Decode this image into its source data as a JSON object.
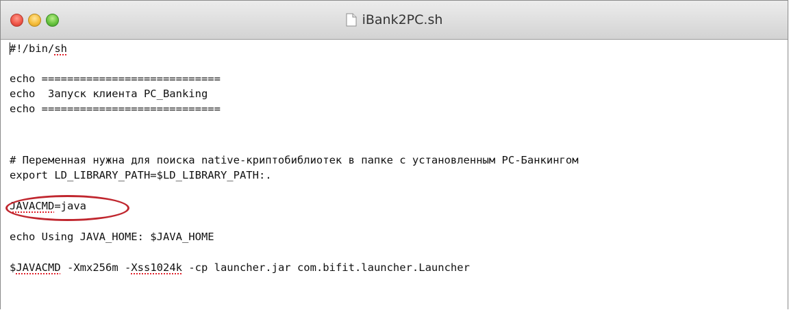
{
  "window": {
    "title": "iBank2PC.sh"
  },
  "editor": {
    "lines": {
      "shebang_prefix": "#!/bin/",
      "shebang_word": "sh",
      "echo_sep_1": "echo ============================",
      "echo_title": "echo  Запуск клиента PC_Banking",
      "echo_sep_2": "echo ============================",
      "comment": "# Переменная нужна для поиска native-криптобиблиотек в папке с установленным PC-Банкингом",
      "export": "export LD_LIBRARY_PATH=$LD_LIBRARY_PATH:.",
      "javacmd_name": "JAVACMD",
      "javacmd_value": "=java",
      "echo_java_home": "echo Using JAVA_HOME: $JAVA_HOME",
      "run_dollar": "$",
      "run_javacmd": "JAVACMD",
      "run_mid": " -Xmx256m -",
      "run_xss": "Xss1024k",
      "run_rest": " -cp launcher.jar com.bifit.launcher.Launcher"
    }
  },
  "colors": {
    "highlight_oval": "#c0262e",
    "spellcheck_underline": "#e0202a"
  },
  "icons": {
    "close": "red-close-button-icon",
    "minimize": "yellow-minimize-button-icon",
    "zoom": "green-zoom-button-icon",
    "document": "document-icon"
  }
}
